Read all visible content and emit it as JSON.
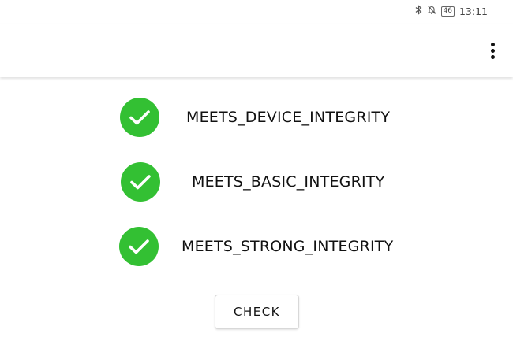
{
  "status_bar": {
    "battery": "46",
    "time": "13:11",
    "icons": [
      "bluetooth-icon",
      "notifications-off-icon",
      "battery-icon"
    ]
  },
  "app_bar": {
    "menu_icon": "more-vert-icon"
  },
  "checks": [
    {
      "label": "MEETS_DEVICE_INTEGRITY",
      "status": "passed",
      "icon": "check-circle-icon",
      "color": "#33c033"
    },
    {
      "label": "MEETS_BASIC_INTEGRITY",
      "status": "passed",
      "icon": "check-circle-icon",
      "color": "#33c033"
    },
    {
      "label": "MEETS_STRONG_INTEGRITY",
      "status": "passed",
      "icon": "check-circle-icon",
      "color": "#33c033"
    }
  ],
  "check_button": {
    "label": "CHECK"
  }
}
